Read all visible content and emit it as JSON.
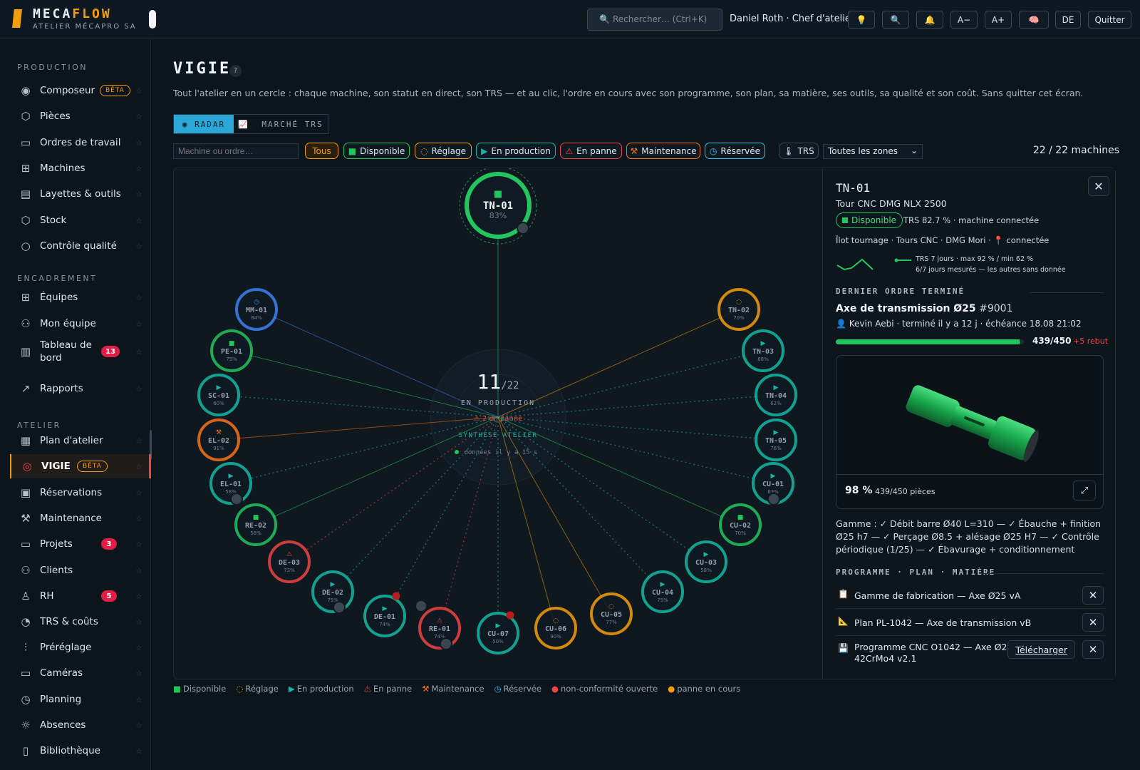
{
  "brand": {
    "name_a": "MECA",
    "name_b": "FLOW",
    "sub": "ATELIER MÉCAPRO SA"
  },
  "header": {
    "search_placeholder": "Rechercher…  (Ctrl+K)",
    "user": "Daniel Roth · Chef d'atelier",
    "buttons": [
      "💡",
      "🔍",
      "🔔",
      "A−",
      "A+",
      "🧠",
      "DE",
      "Quitter"
    ]
  },
  "sidebar": {
    "sections": [
      "PRODUCTION",
      "ENCADREMENT",
      "ATELIER"
    ],
    "items": [
      {
        "label": "Composeur",
        "icon": "composer-icon",
        "glyph": "◉",
        "beta": "BÊTA"
      },
      {
        "label": "Pièces",
        "icon": "cube-icon",
        "glyph": "⬡"
      },
      {
        "label": "Ordres de travail",
        "icon": "clipboard-icon",
        "glyph": "▭"
      },
      {
        "label": "Machines",
        "icon": "grid-icon",
        "glyph": "⊞"
      },
      {
        "label": "Layettes & outils",
        "icon": "archive-icon",
        "glyph": "▤"
      },
      {
        "label": "Stock",
        "icon": "box-icon",
        "glyph": "⬡"
      },
      {
        "label": "Contrôle qualité",
        "icon": "search-icon",
        "glyph": "○"
      },
      {
        "label": "Équipes",
        "icon": "grid-icon",
        "glyph": "⊞"
      },
      {
        "label": "Mon équipe",
        "icon": "users-icon",
        "glyph": "⚇"
      },
      {
        "label": "Tableau de bord",
        "icon": "bar-chart-icon",
        "glyph": "▥",
        "count": "13"
      },
      {
        "label": "Rapports",
        "icon": "trend-icon",
        "glyph": "↗"
      },
      {
        "label": "Plan d'atelier",
        "icon": "map-icon",
        "glyph": "▦"
      },
      {
        "label": "VIGIE",
        "icon": "target-icon",
        "glyph": "◎",
        "beta": "BÊTA"
      },
      {
        "label": "Réservations",
        "icon": "calendar-icon",
        "glyph": "▣"
      },
      {
        "label": "Maintenance",
        "icon": "wrench-icon",
        "glyph": "⚒"
      },
      {
        "label": "Projets",
        "icon": "folder-icon",
        "glyph": "▭",
        "count": "3"
      },
      {
        "label": "Clients",
        "icon": "users-icon",
        "glyph": "⚇"
      },
      {
        "label": "RH",
        "icon": "user-icon",
        "glyph": "♙",
        "count": "5"
      },
      {
        "label": "TRS & coûts",
        "icon": "gauge-icon",
        "glyph": "◔"
      },
      {
        "label": "Préréglage",
        "icon": "sliders-icon",
        "glyph": "⫶"
      },
      {
        "label": "Caméras",
        "icon": "monitor-icon",
        "glyph": "▭"
      },
      {
        "label": "Planning",
        "icon": "clock-icon",
        "glyph": "◷"
      },
      {
        "label": "Absences",
        "icon": "sun-icon",
        "glyph": "☼"
      },
      {
        "label": "Bibliothèque",
        "icon": "book-icon",
        "glyph": "▯"
      }
    ]
  },
  "page": {
    "title": "VIGIE",
    "help": "?",
    "subtitle": "Tout l'atelier en un cercle : chaque machine, son statut en direct, son TRS — et au clic, l'ordre en cours avec son programme, son plan, sa matière, ses outils, sa qualité et son coût. Sans quitter cet écran.",
    "tabs": [
      "RADAR",
      "MARCHÉ TRS"
    ],
    "filter_placeholder": "Machine ou ordre…",
    "chips": [
      "Tous",
      "Disponible",
      "Réglage",
      "En production",
      "En panne",
      "Maintenance",
      "Réservée",
      "TRS"
    ],
    "zone": "Toutes les zones",
    "machine_count": "22 / 22 machines"
  },
  "radar": {
    "center_count": "11",
    "center_total": "/22",
    "center_label": "EN PRODUCTION",
    "center_alert": "⚠ 2 en panne",
    "center_synth": "SYNTHÈSE ATELIER",
    "center_data": "données il y a 15 s",
    "machines": [
      {
        "id": "TN-01",
        "trs": "83%",
        "status": "available"
      },
      {
        "id": "TN-02",
        "trs": "70%",
        "status": "setup"
      },
      {
        "id": "TN-03",
        "trs": "88%",
        "status": "production"
      },
      {
        "id": "TN-04",
        "trs": "62%",
        "status": "production"
      },
      {
        "id": "TN-05",
        "trs": "76%",
        "status": "production"
      },
      {
        "id": "CU-01",
        "trs": "83%",
        "status": "production"
      },
      {
        "id": "CU-02",
        "trs": "70%",
        "status": "available"
      },
      {
        "id": "CU-03",
        "trs": "58%",
        "status": "production"
      },
      {
        "id": "CU-04",
        "trs": "75%",
        "status": "production"
      },
      {
        "id": "CU-05",
        "trs": "77%",
        "status": "setup"
      },
      {
        "id": "CU-06",
        "trs": "90%",
        "status": "setup"
      },
      {
        "id": "CU-07",
        "trs": "50%",
        "status": "production"
      },
      {
        "id": "RE-01",
        "trs": "74%",
        "status": "down"
      },
      {
        "id": "DE-01",
        "trs": "74%",
        "status": "production"
      },
      {
        "id": "DE-02",
        "trs": "75%",
        "status": "production"
      },
      {
        "id": "DE-03",
        "trs": "73%",
        "status": "down"
      },
      {
        "id": "RE-02",
        "trs": "58%",
        "status": "available"
      },
      {
        "id": "EL-01",
        "trs": "58%",
        "status": "production"
      },
      {
        "id": "EL-02",
        "trs": "91%",
        "status": "maintenance"
      },
      {
        "id": "SC-01",
        "trs": "60%",
        "status": "production"
      },
      {
        "id": "PE-01",
        "trs": "75%",
        "status": "available"
      },
      {
        "id": "MM-01",
        "trs": "84%",
        "status": "reserved"
      }
    ]
  },
  "panel": {
    "machine": "TN-01",
    "model": "Tour CNC DMG NLX 2500",
    "status": "Disponible",
    "trs_line": "TRS 82.7 % · machine connectée",
    "location": "Îlot tournage · Tours CNC · DMG Mori · 📍 connectée",
    "trs_note_1": "TRS 7 jours · max 92 % / min 62 %",
    "trs_note_2": "6/7 jours mesurés — les autres sans donnée",
    "sec_last": "DERNIER ORDRE TERMINÉ",
    "order_name": "Axe de transmission Ø25",
    "order_num": " #9001",
    "order_who": "👤 Kevin Aebi · terminé il y a 12 j · échéance 18.08 21:02",
    "progress": 0.9756,
    "qty": "439/450",
    "rebut": "+5 rebut",
    "viewer_pct": "98 %",
    "viewer_pcs": "439/450 pièces",
    "gamme": "Gamme : ✓ Débit barre Ø40 L=310 — ✓ Ébauche + finition Ø25 h7 — ✓ Perçage Ø8.5 + alésage Ø25 H7 — ✓ Contrôle périodique (1/25) — ✓ Ébavurage + conditionnement",
    "sec_prog": "PROGRAMME · PLAN · MATIÈRE",
    "docs": [
      {
        "icon": "📋",
        "label": "Gamme de fabrication — Axe Ø25 vA"
      },
      {
        "icon": "📐",
        "label": "Plan PL-1042 — Axe de transmission vB"
      },
      {
        "icon": "💾",
        "label": "Programme CNC O1042 — Axe Ø25 42CrMo4 v2.1",
        "download": "Télécharger"
      }
    ]
  },
  "legend": [
    {
      "sym": "■",
      "label": "Disponible",
      "color": "#22c55e"
    },
    {
      "sym": "◌",
      "label": "Réglage",
      "color": "#f59e0b"
    },
    {
      "sym": "▶",
      "label": "En production",
      "color": "#14b8a6"
    },
    {
      "sym": "⚠",
      "label": "En panne",
      "color": "#ef4444"
    },
    {
      "sym": "⚒",
      "label": "Maintenance",
      "color": "#f97316"
    },
    {
      "sym": "◷",
      "label": "Réservée",
      "color": "#38bdf8"
    },
    {
      "sym": "●",
      "label": "non-conformité ouverte",
      "color": "#ef4444"
    },
    {
      "sym": "●",
      "label": "panne en cours",
      "color": "#f59e0b"
    }
  ],
  "colors": {
    "available": "#22c55e",
    "setup": "#f59e0b",
    "production": "#14b8a6",
    "down": "#ef4444",
    "maintenance": "#f97316",
    "reserved": "#3b82f6",
    "accent": "#f59e0b"
  }
}
